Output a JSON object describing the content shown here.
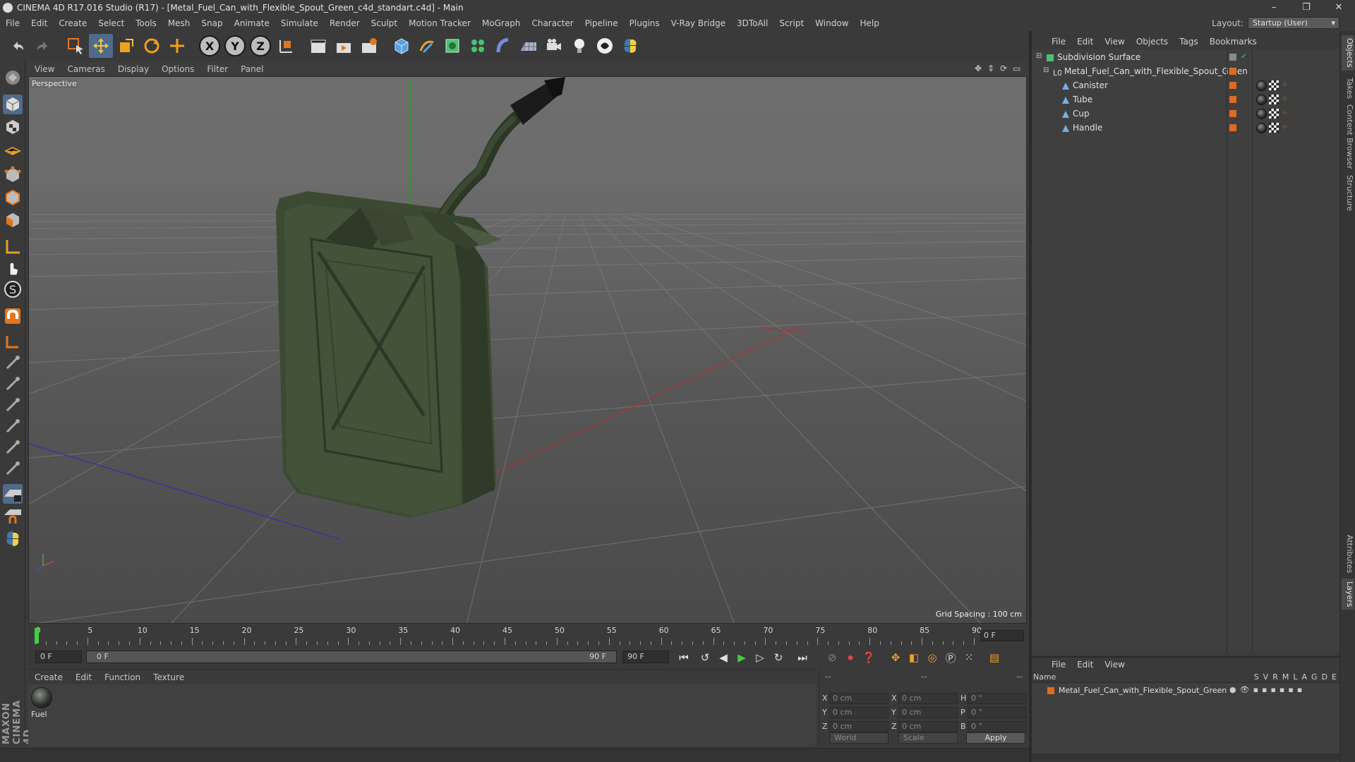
{
  "window": {
    "title": "CINEMA 4D R17.016 Studio (R17) - [Metal_Fuel_Can_with_Flexible_Spout_Green_c4d_standart.c4d] - Main",
    "controls": [
      "–",
      "❐",
      "✕"
    ]
  },
  "menubar": {
    "items": [
      "File",
      "Edit",
      "Create",
      "Select",
      "Tools",
      "Mesh",
      "Snap",
      "Animate",
      "Simulate",
      "Render",
      "Sculpt",
      "Motion Tracker",
      "MoGraph",
      "Character",
      "Pipeline",
      "Plugins",
      "V-Ray Bridge",
      "3DToAll",
      "Script",
      "Window",
      "Help"
    ],
    "layout_label": "Layout:",
    "layout_value": "Startup (User)"
  },
  "toolbar": {
    "axis_buttons": [
      "X",
      "Y",
      "Z"
    ]
  },
  "viewport": {
    "menu": [
      "View",
      "Cameras",
      "Display",
      "Options",
      "Filter",
      "Panel"
    ],
    "camera_label": "Perspective",
    "grid_spacing": "Grid Spacing : 100 cm",
    "model_color": "#3f4a34"
  },
  "timeline": {
    "ticks": [
      0,
      5,
      10,
      15,
      20,
      25,
      30,
      35,
      40,
      45,
      50,
      55,
      60,
      65,
      70,
      75,
      80,
      85,
      90
    ],
    "current_frame": "0 F"
  },
  "transport": {
    "start_field": "0 F",
    "slider_left": "0 F",
    "slider_right": "90 F",
    "end_field": "90 F"
  },
  "material_manager": {
    "menu": [
      "Create",
      "Edit",
      "Function",
      "Texture"
    ],
    "materials": [
      {
        "name": "Fuel"
      }
    ]
  },
  "coordinates": {
    "header": [
      "--",
      "--",
      "--"
    ],
    "rows": [
      {
        "axis": "X",
        "pos": "0 cm",
        "size_axis": "X",
        "size": "0 cm",
        "rot_axis": "H",
        "rot": "0 °"
      },
      {
        "axis": "Y",
        "pos": "0 cm",
        "size_axis": "Y",
        "size": "0 cm",
        "rot_axis": "P",
        "rot": "0 °"
      },
      {
        "axis": "Z",
        "pos": "0 cm",
        "size_axis": "Z",
        "size": "0 cm",
        "rot_axis": "B",
        "rot": "0 °"
      }
    ],
    "mode": "World",
    "scale": "Scale",
    "apply": "Apply"
  },
  "object_manager": {
    "menu": [
      "File",
      "Edit",
      "View",
      "Objects",
      "Tags",
      "Bookmarks"
    ],
    "objects": [
      {
        "name": "Subdivision Surface",
        "type": "subdivision"
      },
      {
        "name": "Metal_Fuel_Can_with_Flexible_Spout_Green",
        "type": "null"
      },
      {
        "name": "Canister",
        "type": "polygon"
      },
      {
        "name": "Tube",
        "type": "polygon"
      },
      {
        "name": "Cup",
        "type": "polygon"
      },
      {
        "name": "Handle",
        "type": "polygon"
      }
    ]
  },
  "layer_manager": {
    "menu": [
      "File",
      "Edit",
      "View"
    ],
    "header_name": "Name",
    "columns": [
      "S",
      "V",
      "R",
      "M",
      "L",
      "A",
      "G",
      "D",
      "E"
    ],
    "layers": [
      {
        "name": "Metal_Fuel_Can_with_Flexible_Spout_Green"
      }
    ]
  },
  "side_tabs": [
    "Objects",
    "Takes",
    "Content Browser",
    "Structure",
    "Attributes",
    "Layers"
  ],
  "branding": "MAXON CINEMA 4D"
}
